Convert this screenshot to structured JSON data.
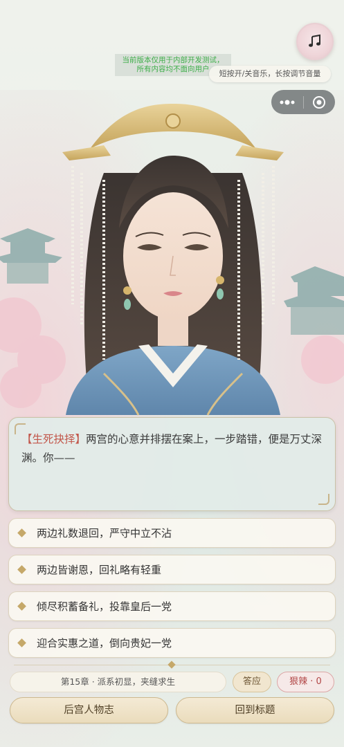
{
  "dev_notice": [
    "当前版本仅用于内部开发测试，",
    "所有内容均不面向用户"
  ],
  "music": {
    "icon": "music-note-icon",
    "tip": "短按开/关音乐，长按调节音量"
  },
  "capsule": {
    "more_icon": "more-dots-icon",
    "close_icon": "target-circle-icon"
  },
  "dialog": {
    "tag": "【生死抉择】",
    "text": "两宫的心意并排摆在案上，一步踏错，便是万丈深渊。你——"
  },
  "choices": [
    {
      "label": "两边礼数退回，严守中立不沾"
    },
    {
      "label": "两边皆谢恩，回礼略有轻重"
    },
    {
      "label": "倾尽积蓄备礼，投靠皇后一党"
    },
    {
      "label": "迎合实惠之道，倒向贵妃一党"
    }
  ],
  "status": {
    "chapter": "第15章 · 派系初显，夹缝求生",
    "answer_badge": "答应",
    "fierce_badge": "狠辣 · 0"
  },
  "buttons": {
    "harem": "后宫人物志",
    "back_title": "回到标题"
  },
  "colors": {
    "accent_gold": "#c5a869",
    "tag_red": "#c2574b",
    "dev_green": "#3fae4a",
    "fierce_red": "#b24848"
  }
}
